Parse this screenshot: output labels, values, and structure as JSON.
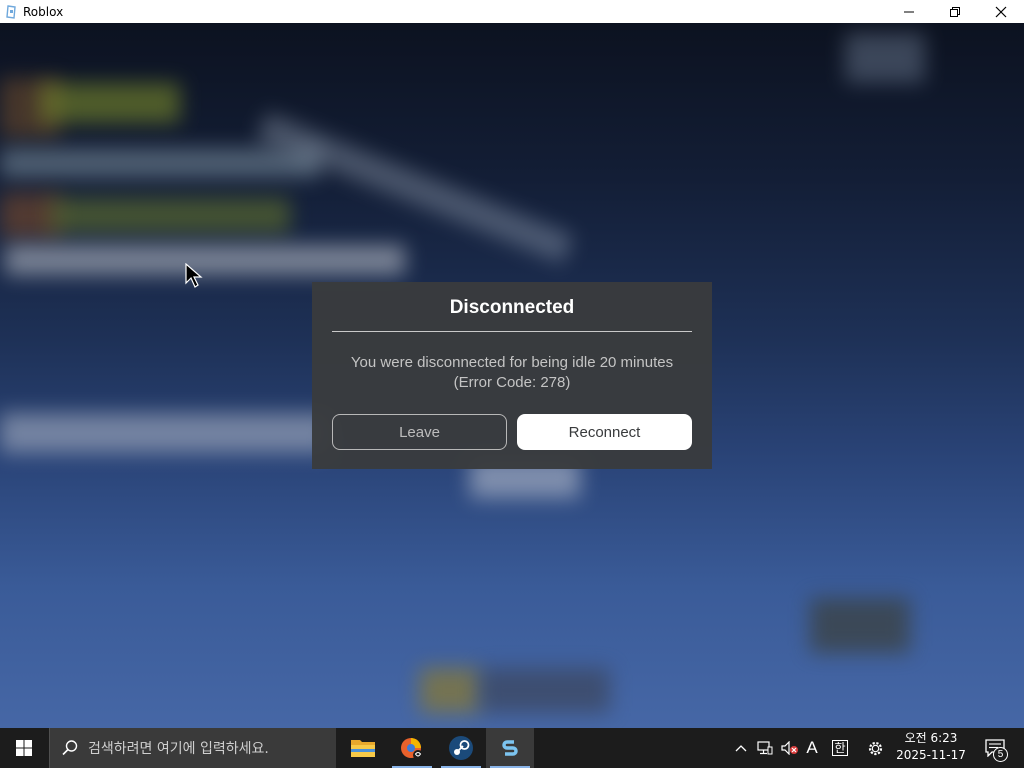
{
  "window": {
    "title": "Roblox",
    "icon": "roblox-icon",
    "controls": [
      "minimize-icon",
      "restore-icon",
      "close-icon"
    ]
  },
  "dialog": {
    "title": "Disconnected",
    "message_line1": "You were disconnected for being idle 20 minutes",
    "message_line2": "(Error Code: 278)",
    "leave_label": "Leave",
    "reconnect_label": "Reconnect"
  },
  "taskbar": {
    "start_icon": "windows-start-icon",
    "search_placeholder": "검색하려면 여기에 입력하세요.",
    "apps": [
      {
        "name": "file-explorer-icon",
        "active": false
      },
      {
        "name": "browser-icon",
        "active": false
      },
      {
        "name": "steam-icon",
        "active": false
      },
      {
        "name": "roblox-studio-icon",
        "active": true
      }
    ],
    "tray": {
      "icons": [
        "chevron-up-icon",
        "network-icon",
        "volume-muted-icon",
        "ime-a-icon",
        "ime-korean-icon",
        "gear-icon"
      ],
      "ime_letter": "A",
      "ime_korean": "한",
      "time": "오전 6:23",
      "date": "2025-11-17",
      "notification_count": "5"
    }
  },
  "colors": {
    "dialog_bg": "#393b3d",
    "button_white": "#ffffff",
    "taskbar_bg": "#1c1c1c"
  }
}
